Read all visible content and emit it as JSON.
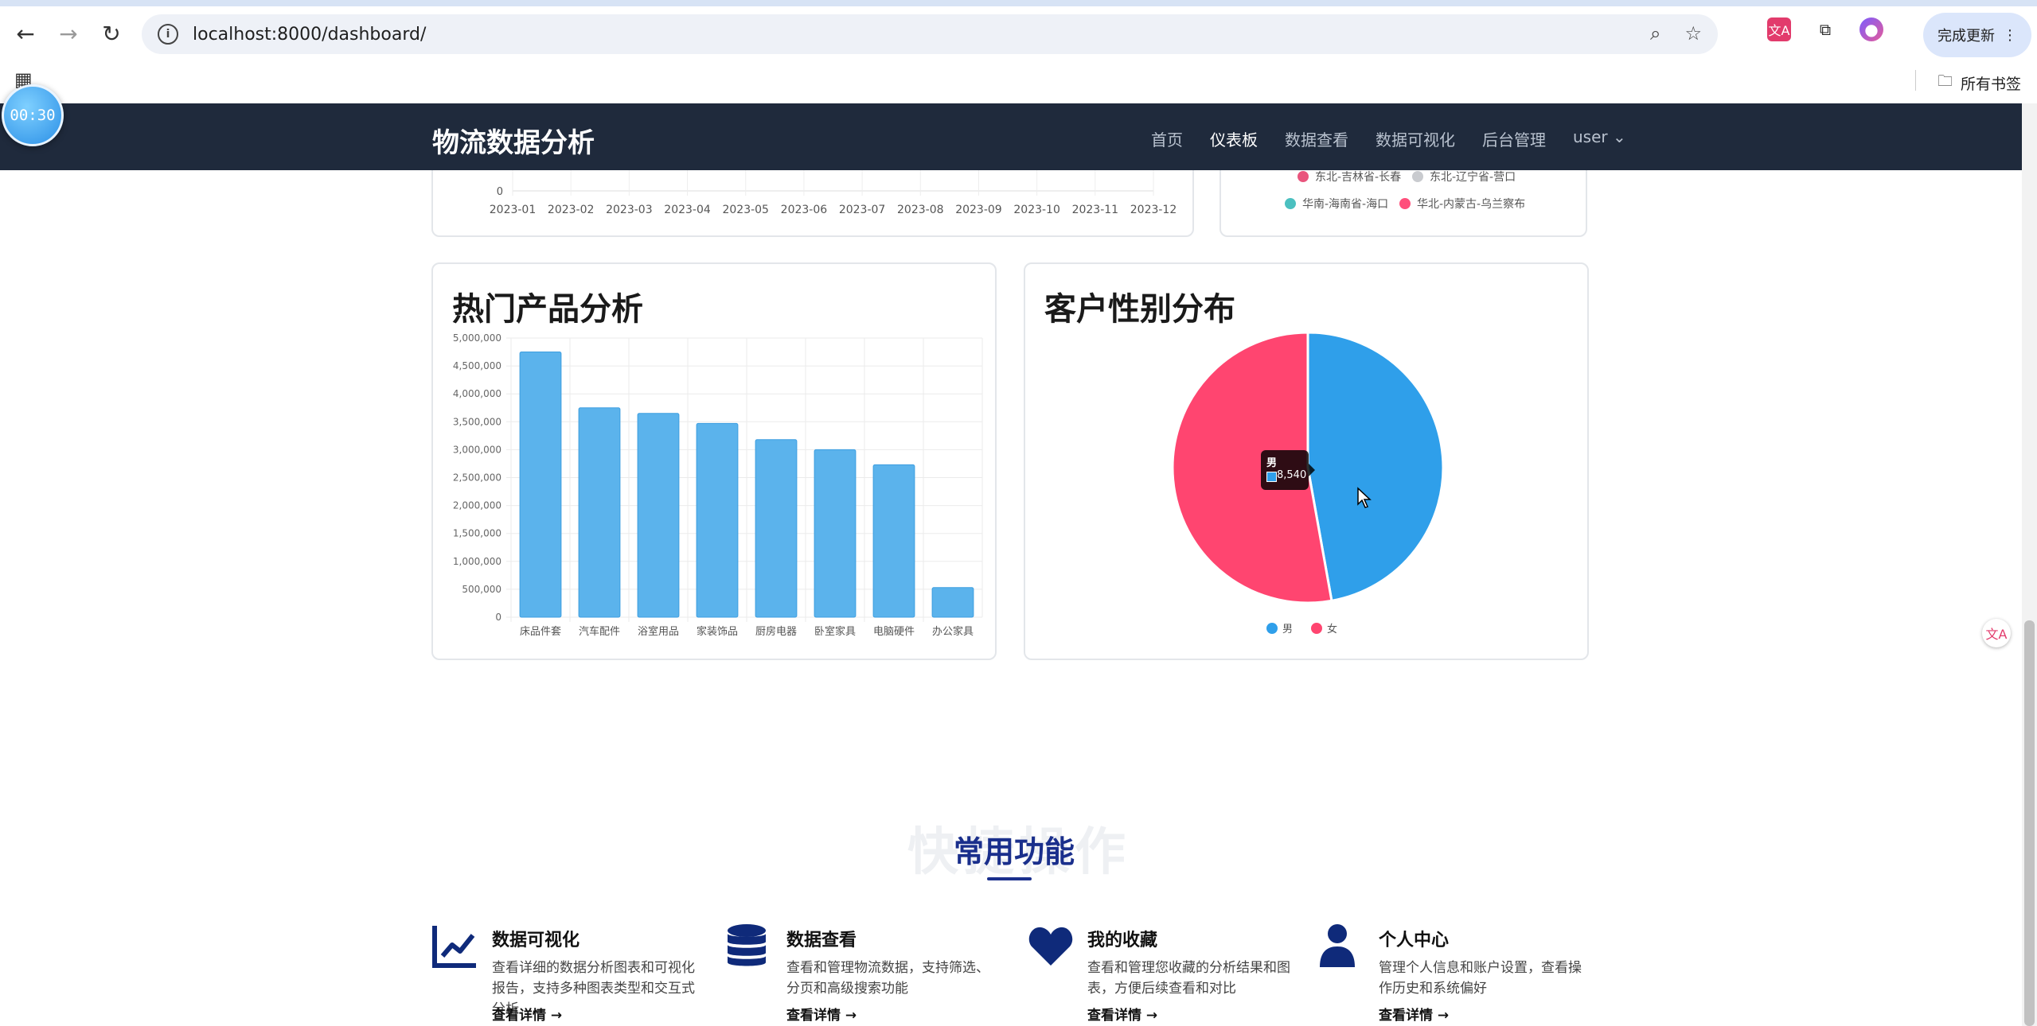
{
  "browser": {
    "url": "localhost:8000/dashboard/",
    "update_label": "完成更新",
    "all_bookmarks_label": "所有书签",
    "translate_label": "文A"
  },
  "timer": {
    "text": "00:30"
  },
  "navbar": {
    "brand": "物流数据分析",
    "links": [
      "首页",
      "仪表板",
      "数据查看",
      "数据可视化",
      "后台管理",
      "user"
    ],
    "active_index": 1
  },
  "line_card": {
    "x_labels": [
      "2023-01",
      "2023-02",
      "2023-03",
      "2023-04",
      "2023-05",
      "2023-06",
      "2023-07",
      "2023-08",
      "2023-09",
      "2023-10",
      "2023-11",
      "2023-12"
    ],
    "y_zero_label": "0"
  },
  "region_legend": {
    "items": [
      {
        "label": "东北-吉林省-长春",
        "color": "#e9557d"
      },
      {
        "label": "东北-辽宁省-营口",
        "color": "#c9cbcf"
      },
      {
        "label": "华南-海南省-海口",
        "color": "#4bc0c0"
      },
      {
        "label": "华北-内蒙古-乌兰察布",
        "color": "#ff4f7b"
      }
    ]
  },
  "products_card": {
    "title": "热门产品分析"
  },
  "gender_card": {
    "title": "客户性别分布",
    "tooltip": {
      "label": "男",
      "value": "8,540"
    }
  },
  "chart_data": [
    {
      "type": "bar",
      "title": "热门产品分析",
      "categories": [
        "床品件套",
        "汽车配件",
        "浴室用品",
        "家装饰品",
        "厨房电器",
        "卧室家具",
        "电脑硬件",
        "办公家具"
      ],
      "values": [
        4750000,
        3750000,
        3650000,
        3470000,
        3180000,
        3000000,
        2730000,
        530000
      ],
      "ylim": [
        0,
        5000000
      ],
      "y_ticks": [
        "5,000,000",
        "4,500,000",
        "4,000,000",
        "3,500,000",
        "3,000,000",
        "2,500,000",
        "2,000,000",
        "1,500,000",
        "1,000,000",
        "500,000",
        "0"
      ],
      "color": "#5bb3ec",
      "grid": true
    },
    {
      "type": "pie",
      "title": "客户性别分布",
      "series": [
        {
          "name": "男",
          "value": 8540,
          "color": "#2f9fea"
        },
        {
          "name": "女",
          "value": 9560,
          "color": "#ff4570"
        }
      ],
      "legend": "bottom"
    }
  ],
  "quick": {
    "ghost_title": "快捷操作",
    "title": "常用功能",
    "features": [
      {
        "icon": "chart-line-icon",
        "title": "数据可视化",
        "desc": "查看详细的数据分析图表和可视化报告，支持多种图表类型和交互式分析",
        "link": "查看详情 →"
      },
      {
        "icon": "database-icon",
        "title": "数据查看",
        "desc": "查看和管理物流数据，支持筛选、分页和高级搜索功能",
        "link": "查看详情 →"
      },
      {
        "icon": "heart-icon",
        "title": "我的收藏",
        "desc": "查看和管理您收藏的分析结果和图表，方便后续查看和对比",
        "link": "查看详情 →"
      },
      {
        "icon": "user-icon",
        "title": "个人中心",
        "desc": "管理个人信息和账户设置，查看操作历史和系统偏好",
        "link": "查看详情 →"
      }
    ]
  }
}
